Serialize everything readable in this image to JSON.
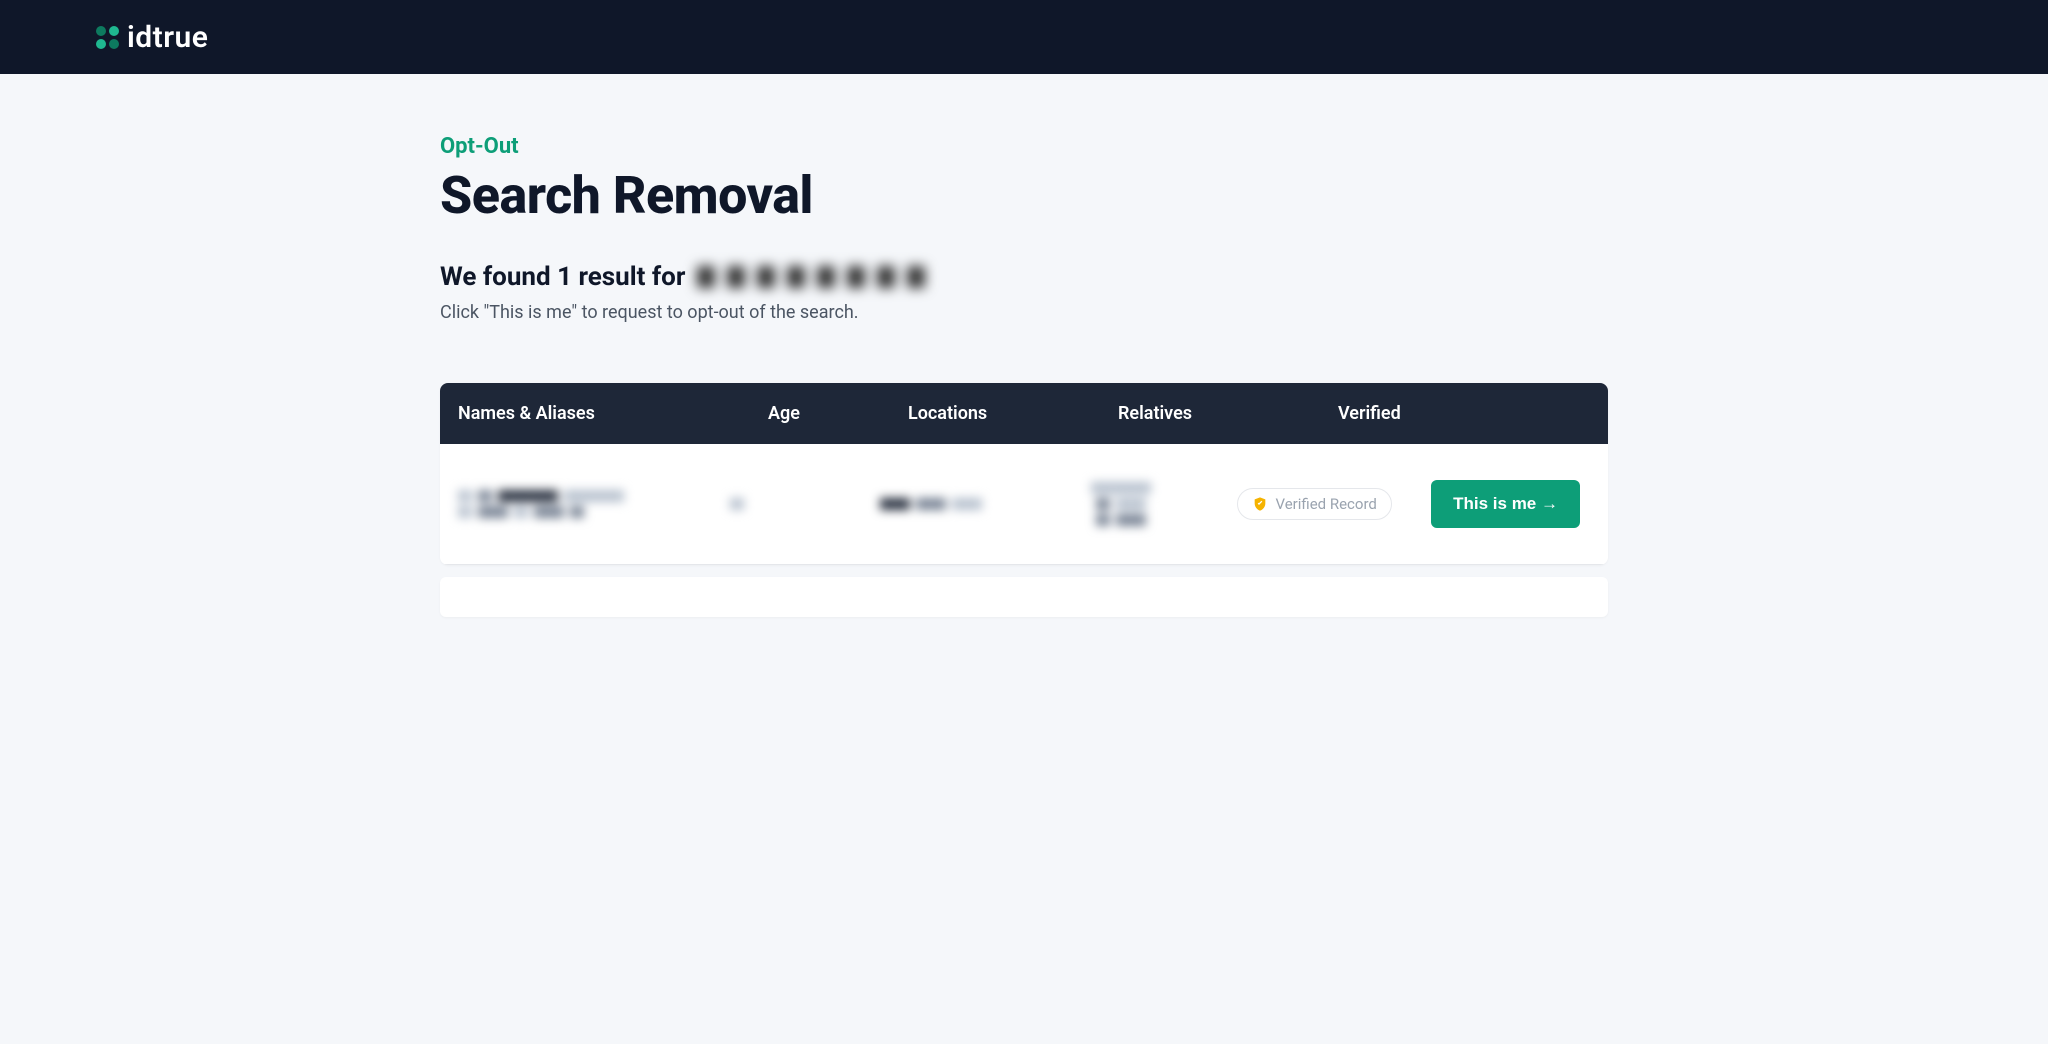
{
  "brand": {
    "name": "idtrue"
  },
  "page": {
    "eyebrow": "Opt-Out",
    "title": "Search Removal",
    "result_prefix": "We found 1 result for",
    "searched_name": "[redacted]",
    "instruction": "Click \"This is me\" to request to opt-out of the search."
  },
  "table": {
    "headers": {
      "names": "Names & Aliases",
      "age": "Age",
      "locations": "Locations",
      "relatives": "Relatives",
      "verified": "Verified"
    },
    "rows": [
      {
        "names": "[redacted]",
        "age": "[redacted]",
        "locations": "[redacted]",
        "relatives": "[redacted]",
        "verified_label": "Verified Record",
        "action_label": "This is me →"
      }
    ]
  }
}
